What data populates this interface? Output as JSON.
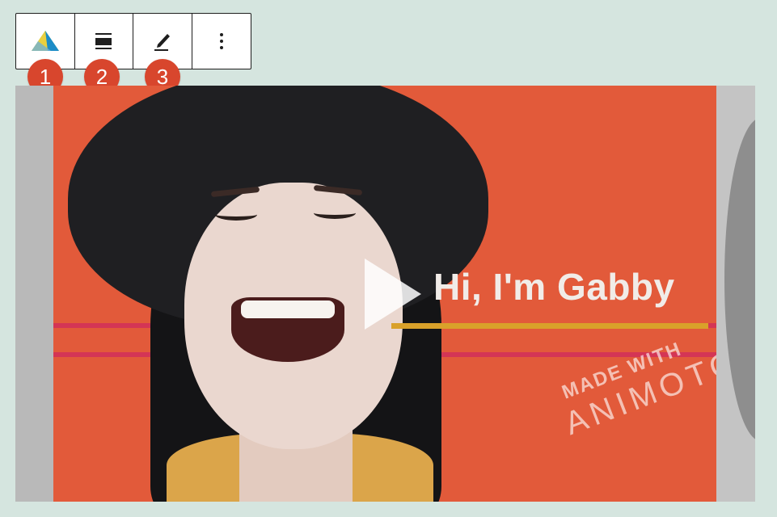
{
  "toolbar": {
    "items": [
      {
        "name": "animoto-logo-icon",
        "badge": "1"
      },
      {
        "name": "align-icon",
        "badge": "2"
      },
      {
        "name": "edit-pencil-icon",
        "badge": "3"
      },
      {
        "name": "more-options-icon"
      }
    ],
    "more_label": "⋮"
  },
  "badges": [
    "1",
    "2",
    "3"
  ],
  "video": {
    "title_text": "Hi, I'm Gabby",
    "watermark_line1": "MADE WITH",
    "watermark_line2": "ANIMOTO"
  },
  "colors": {
    "background": "#d5e5df",
    "badge": "#d8462d",
    "video_backdrop": "#e25a3a",
    "underline": "#d9a12a"
  }
}
